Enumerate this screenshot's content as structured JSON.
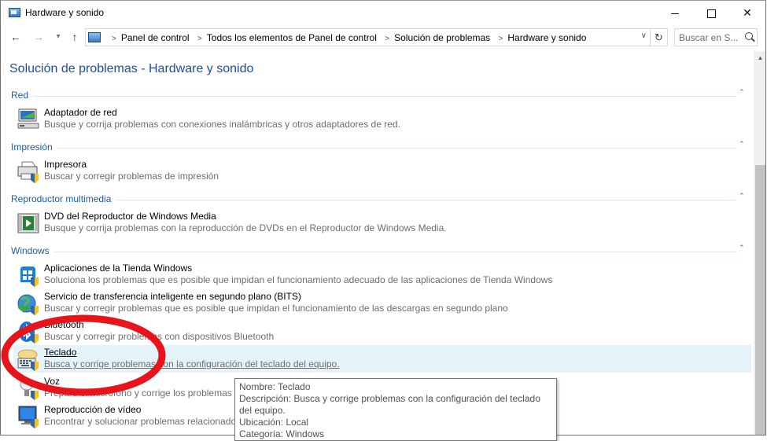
{
  "window": {
    "title": "Hardware y sonido"
  },
  "address": {
    "crumbs": [
      "Panel de control",
      "Todos los elementos de Panel de control",
      "Solución de problemas",
      "Hardware y sonido"
    ],
    "search_placeholder": "Buscar en S..."
  },
  "page": {
    "title": "Solución de problemas - Hardware y sonido"
  },
  "groups": [
    {
      "name": "Red",
      "items": [
        {
          "title": "Adaptador de red",
          "desc": "Busque y corrija problemas con conexiones inalámbricas y otros adaptadores de red.",
          "icon": "network-adapter-icon"
        }
      ]
    },
    {
      "name": "Impresión",
      "items": [
        {
          "title": "Impresora",
          "desc": "Buscar y corregir problemas de impresión",
          "icon": "printer-icon"
        }
      ]
    },
    {
      "name": "Reproductor multimedia",
      "items": [
        {
          "title": "DVD del Reproductor de Windows Media",
          "desc": "Busque y corrija problemas con la reproducción de DVDs en el Reproductor de Windows Media.",
          "icon": "dvd-player-icon"
        }
      ]
    },
    {
      "name": "Windows",
      "items": [
        {
          "title": "Aplicaciones de la Tienda Windows",
          "desc": "Soluciona los problemas que es posible que impidan el funcionamiento adecuado de las aplicaciones de Tienda Windows",
          "icon": "windows-store-icon"
        },
        {
          "title": "Servicio de transferencia inteligente en segundo plano (BITS)",
          "desc": "Buscar y corregir problemas que es posible que impidan el funcionamiento de las descargas en segundo plano",
          "icon": "bits-icon"
        },
        {
          "title": "Bluetooth",
          "desc": "Buscar y corregir problemas con dispositivos Bluetooth",
          "icon": "bluetooth-icon"
        },
        {
          "title": "Teclado",
          "desc": "Busca y corrige problemas con la configuración del teclado del equipo.",
          "icon": "keyboard-icon"
        },
        {
          "title": "Voz",
          "desc": "Prepare el micrófono y corrige los problemas",
          "icon": "speech-icon"
        },
        {
          "title": "Reproducción de vídeo",
          "desc": "Encontrar y solucionar problemas relacionado",
          "icon": "video-playback-icon"
        }
      ]
    }
  ],
  "tooltip": {
    "name": "Nombre: Teclado",
    "description": "Descripción: Busca y corrige problemas con la configuración del teclado del equipo.",
    "location": "Ubicación: Local",
    "category": "Categoría: Windows"
  },
  "colors": {
    "accent": "#1e4e9a",
    "group_header": "#1e5aa8",
    "hover_bg": "#e5f3fb",
    "annotation": "#e8141c"
  }
}
